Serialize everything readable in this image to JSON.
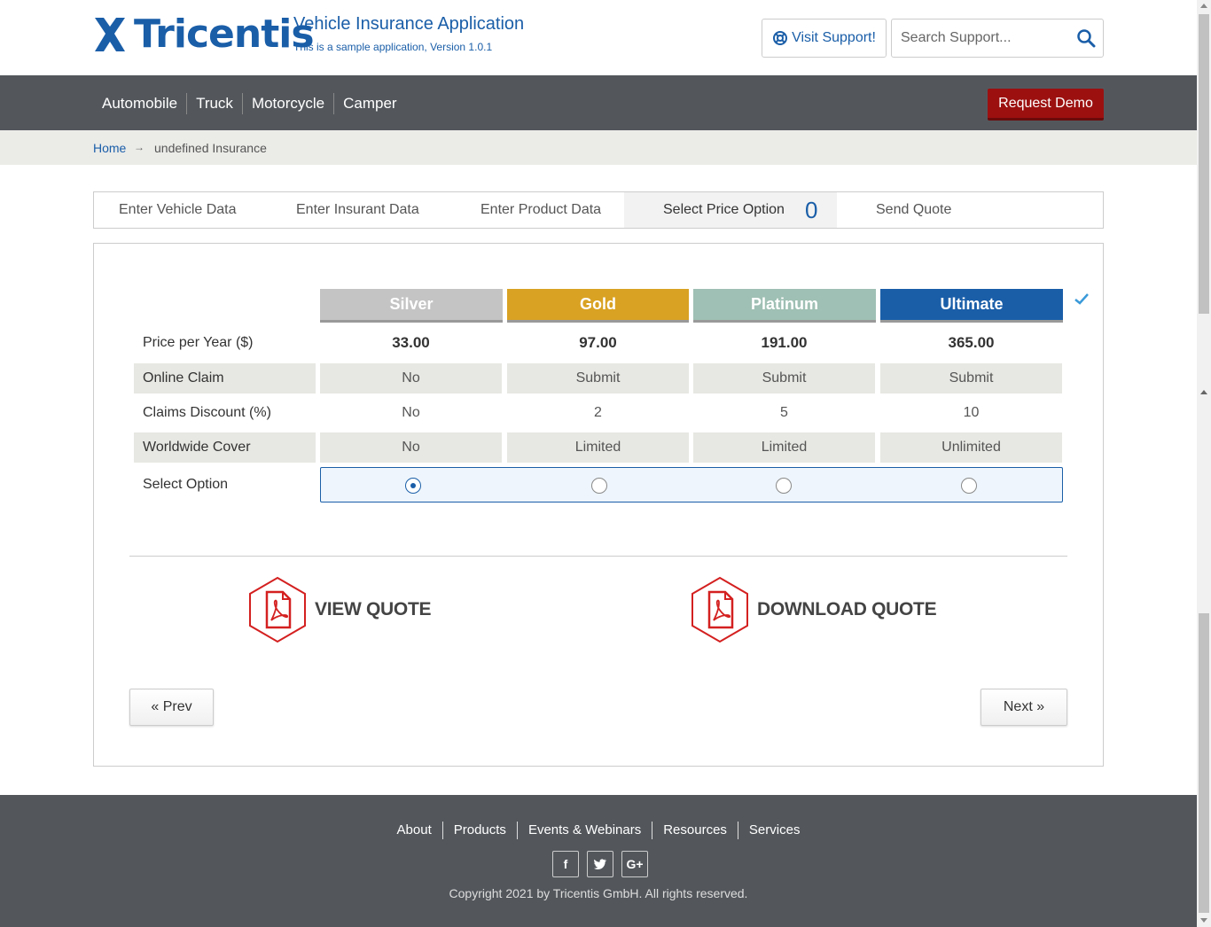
{
  "header": {
    "logo_text": "Tricentis",
    "app_title": "Vehicle Insurance Application",
    "app_subtitle": "This is a sample application, Version 1.0.1",
    "support_label": "Visit Support!",
    "search_placeholder": "Search Support..."
  },
  "nav": {
    "items": [
      "Automobile",
      "Truck",
      "Motorcycle",
      "Camper"
    ],
    "demo_label": "Request Demo"
  },
  "breadcrumb": {
    "home": "Home",
    "current": "undefined Insurance"
  },
  "tabs": {
    "items": [
      "Enter Vehicle Data",
      "Enter Insurant Data",
      "Enter Product Data",
      "Select Price Option",
      "Send Quote"
    ],
    "active_count": "0"
  },
  "plans": {
    "names": [
      "Silver",
      "Gold",
      "Platinum",
      "Ultimate"
    ],
    "colors": [
      "#c4c4c4",
      "#d9a223",
      "#9fc0b4",
      "#1a5ea8"
    ],
    "rows": [
      {
        "label": "Price per Year ($)",
        "values": [
          "33.00",
          "97.00",
          "191.00",
          "365.00"
        ]
      },
      {
        "label": "Online Claim",
        "values": [
          "No",
          "Submit",
          "Submit",
          "Submit"
        ]
      },
      {
        "label": "Claims Discount (%)",
        "values": [
          "No",
          "2",
          "5",
          "10"
        ]
      },
      {
        "label": "Worldwide Cover",
        "values": [
          "No",
          "Limited",
          "Limited",
          "Unlimited"
        ]
      }
    ],
    "select_label": "Select Option",
    "selected_index": 0
  },
  "quote": {
    "view_label": "VIEW QUOTE",
    "download_label": "DOWNLOAD QUOTE"
  },
  "pager": {
    "prev_label": "« Prev",
    "next_label": "Next »"
  },
  "footer": {
    "links": [
      "About",
      "Products",
      "Events & Webinars",
      "Resources",
      "Services"
    ],
    "social": [
      "facebook-icon",
      "twitter-icon",
      "google-plus-icon"
    ],
    "copyright": "Copyright 2021 by Tricentis GmbH. All rights reserved."
  }
}
